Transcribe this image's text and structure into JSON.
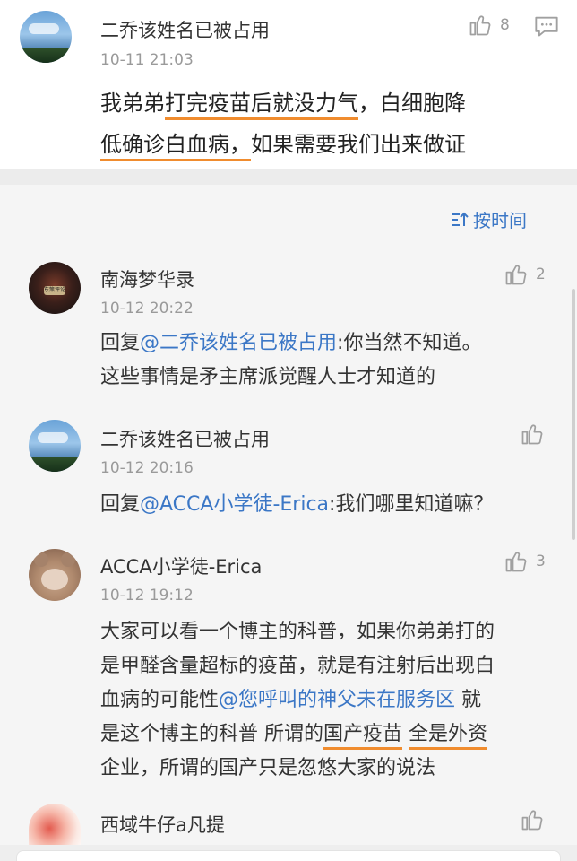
{
  "top_comment": {
    "username": "二乔该姓名已被占用",
    "time": "10-11 21:03",
    "like_count": "8",
    "line1_a": "我弟弟",
    "line1_b": "打完疫苗后就没力气",
    "line1_c": "，白细胞降",
    "line2_a": "低确诊白血病，",
    "line2_b": "如果需要我们出来做证"
  },
  "sort_label": "按时间",
  "replies": [
    {
      "username": "南海梦华录",
      "time": "10-12 20:22",
      "like_count": "2",
      "reply_prefix": "回复",
      "mention": "@二乔该姓名已被占用",
      "line1_rest": ":你当然不知道。",
      "line2": "这些事情是矛主席派觉醒人士才知道的",
      "avatar_badge": "东策评论"
    },
    {
      "username": "二乔该姓名已被占用",
      "time": "10-12 20:16",
      "like_count": "",
      "reply_prefix": "回复",
      "mention": "@ACCA小学徒-Erica",
      "line1_rest": ":我们哪里知道嘛？"
    },
    {
      "username": "ACCA小学徒-Erica",
      "time": "10-12 19:12",
      "like_count": "3",
      "line1": "大家可以看一个博主的科普，如果你弟弟打的",
      "line2": "是甲醛含量超标的疫苗，就是有注射后出现白",
      "line3_a": "血病的可能性",
      "line3_mention": "@您呼叫的神父未在服务区",
      "line3_b": " 就",
      "line4_a": "是这个博主的科普 所谓的",
      "line4_u1": "国产疫苗",
      "line4_mid": " ",
      "line4_u2": "全是外资",
      "line5": "企业，所谓的国产只是忽悠大家的说法"
    },
    {
      "username": "西域牛仔a凡提",
      "time": "",
      "like_count": ""
    }
  ],
  "colors": {
    "mention": "#3b77c6",
    "underline": "#f08c2e",
    "meta": "#9a9a9a"
  },
  "icons": {
    "like": "thumbs-up-icon",
    "comment": "comment-bubble-icon",
    "sort": "sort-icon"
  }
}
